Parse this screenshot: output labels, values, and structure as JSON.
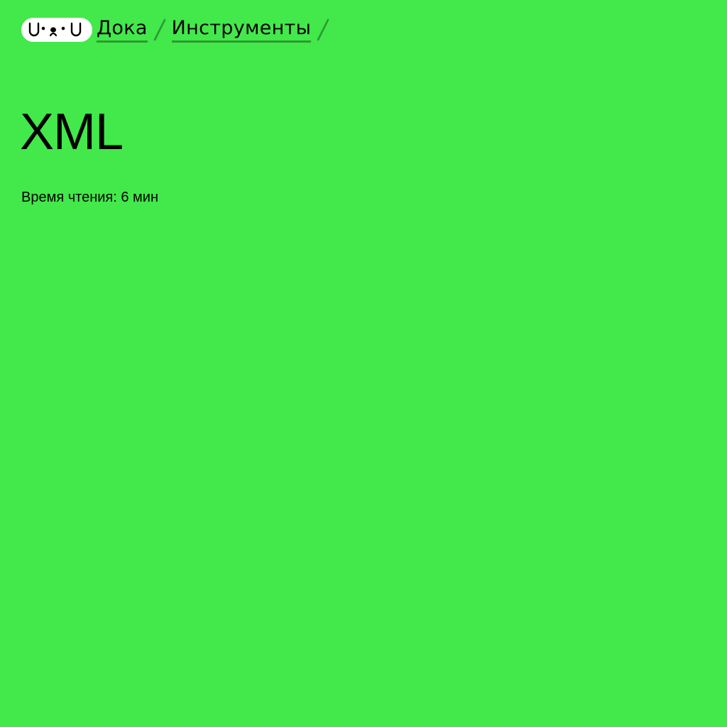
{
  "theme": {
    "background": "#43e84a",
    "underline": "#2a9a31",
    "logo_bg": "#ffffff"
  },
  "logo": {
    "text": "U•ᴥ•U",
    "icon": "doka-dog-face-logo"
  },
  "breadcrumbs": [
    {
      "label": "Дока"
    },
    {
      "label": "Инструменты"
    }
  ],
  "separator_icon": "slash-separator-icon",
  "article": {
    "title": "XML",
    "reading_time_label": "Время чтения:",
    "reading_time_value": "6 мин"
  }
}
